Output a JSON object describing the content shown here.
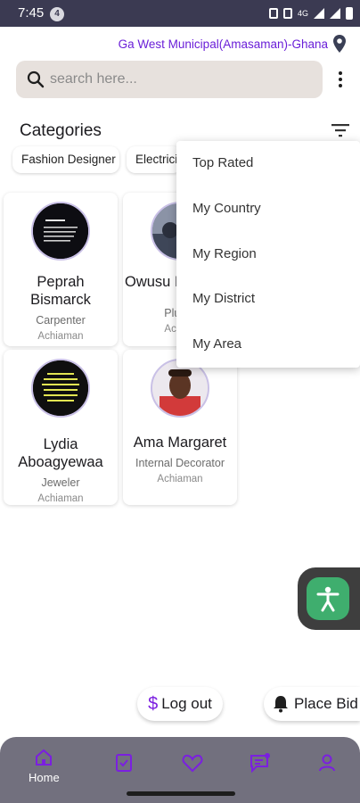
{
  "status_bar": {
    "time": "7:45",
    "notification_count": "4",
    "network": "4G"
  },
  "location": {
    "text": "Ga West Municipal(Amasaman)-Ghana",
    "icon": "location-pin-icon"
  },
  "search": {
    "placeholder": "search here..."
  },
  "categories": {
    "title": "Categories",
    "chips": [
      "Fashion Designer",
      "Electrici"
    ]
  },
  "workers": [
    {
      "name": "Peprah Bismarck",
      "profession": "Carpenter",
      "area": "Achiaman"
    },
    {
      "name": "Owusu I",
      "profession": "Plumb",
      "area": "Achian"
    },
    {
      "name": "Lydia Aboagyewaa",
      "profession": "Jeweler",
      "area": "Achiaman"
    },
    {
      "name": "Ama Margaret",
      "profession": "Internal Decorator",
      "area": "Achiaman"
    }
  ],
  "filter_menu": [
    "Top Rated",
    "My Country",
    "My Region",
    "My District",
    "My Area"
  ],
  "actions": {
    "logout": "Log out",
    "logout_icon": "$",
    "place_bid": "Place Bid"
  },
  "bottom_nav": {
    "home": "Home"
  },
  "colors": {
    "accent": "#6a1ed8",
    "status_bar": "#3b3a52",
    "nav_bg": "#72707e",
    "search_bg": "#e7e1dd",
    "a11y_green": "#3fae6e"
  }
}
